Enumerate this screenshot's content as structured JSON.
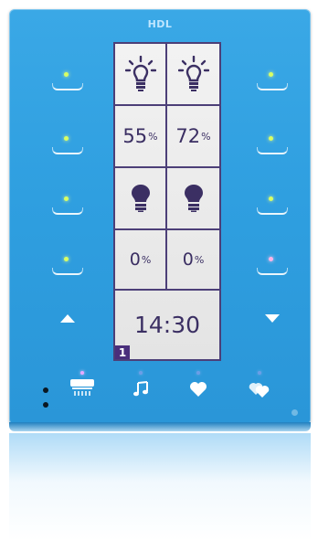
{
  "brand": "HDL",
  "lcd": {
    "row2": {
      "left": "55",
      "right": "72",
      "unit": "%"
    },
    "row4": {
      "left": "0",
      "right": "0",
      "unit": "%"
    },
    "time": "14:30",
    "page": "1"
  },
  "colors": {
    "panel": "#2f9fe0",
    "lcd_border": "#4c3f78",
    "lcd_text": "#3b2f63",
    "page_badge": "#4a2f7c"
  },
  "icons": {
    "row1": "light-on-icon",
    "row3": "light-off-icon",
    "bottom": [
      "air-conditioner-icon",
      "music-note-icon",
      "heart-icon",
      "heart-pair-icon"
    ]
  }
}
